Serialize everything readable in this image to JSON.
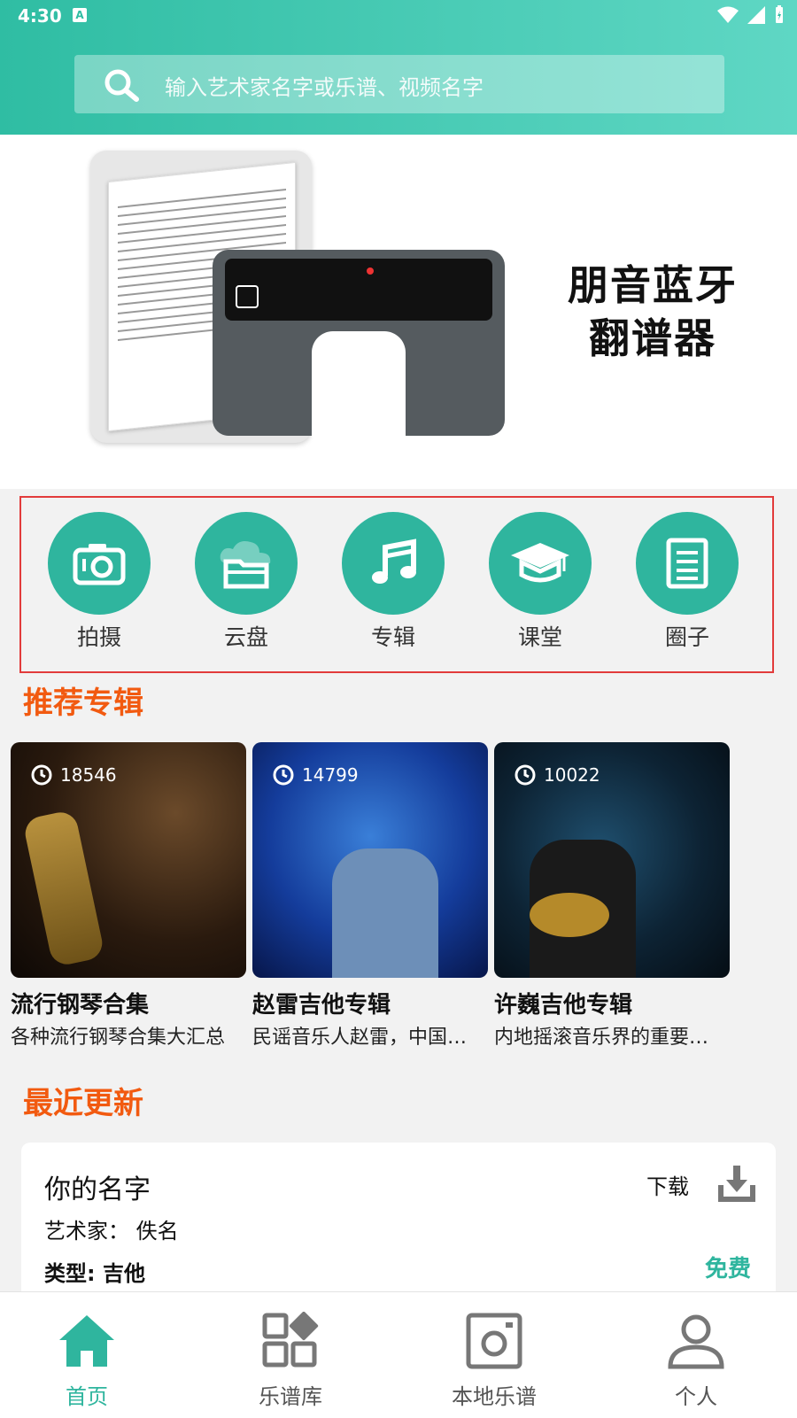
{
  "status_bar": {
    "time": "4:30",
    "notif_icon": "A"
  },
  "search": {
    "placeholder": "输入艺术家名字或乐谱、视频名字"
  },
  "banner": {
    "line1": "朋音蓝牙",
    "line2": "翻谱器"
  },
  "quick_actions": [
    {
      "label": "拍摄",
      "icon": "camera-icon"
    },
    {
      "label": "云盘",
      "icon": "cloud-folder-icon"
    },
    {
      "label": "专辑",
      "icon": "music-note-icon"
    },
    {
      "label": "课堂",
      "icon": "graduation-cap-icon"
    },
    {
      "label": "圈子",
      "icon": "document-icon"
    }
  ],
  "recommended": {
    "title": "推荐专辑",
    "albums": [
      {
        "count": "18546",
        "title": "流行钢琴合集",
        "desc": "各种流行钢琴合集大汇总"
      },
      {
        "count": "14799",
        "title": "赵雷吉他专辑",
        "desc": "民谣音乐人赵雷，中国…"
      },
      {
        "count": "10022",
        "title": "许巍吉他专辑",
        "desc": "内地摇滚音乐界的重要…"
      }
    ]
  },
  "recent": {
    "title": "最近更新",
    "item": {
      "name": "你的名字",
      "artist": "艺术家：  佚名",
      "type": "类型: 吉他",
      "download_label": "下载",
      "price": "免费"
    }
  },
  "bottom_nav": [
    {
      "label": "首页",
      "active": true
    },
    {
      "label": "乐谱库",
      "active": false
    },
    {
      "label": "本地乐谱",
      "active": false
    },
    {
      "label": "个人",
      "active": false
    }
  ],
  "colors": {
    "accent": "#2fb59e",
    "section_title": "#f25a10",
    "highlight_border": "#e23b3b"
  }
}
